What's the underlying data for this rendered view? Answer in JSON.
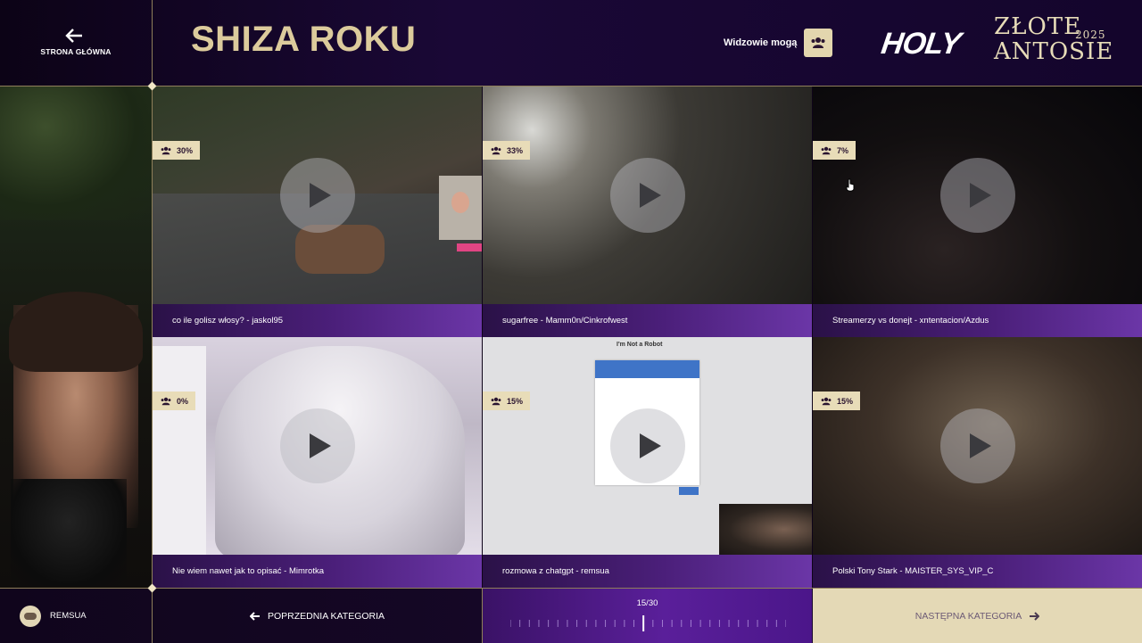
{
  "header": {
    "home_label": "STRONA GŁÓWNA",
    "category_title": "SHIZA ROKU",
    "viewers_label": "Widzowie mogą",
    "logo_brand": "HOLY",
    "logo_line1": "ZŁOTE",
    "logo_line2": "ANTOSIE",
    "logo_year": "2025"
  },
  "videos": [
    {
      "percent": "30%",
      "title": "co ile golisz włosy? - jaskol95"
    },
    {
      "percent": "33%",
      "title": "sugarfree - Mamm0n/Cinkrofwest"
    },
    {
      "percent": "7%",
      "title": "Streamerzy vs donejt - xntentacion/Azdus"
    },
    {
      "percent": "0%",
      "title": "Nie wiem nawet jak to opisać - Mimrotka"
    },
    {
      "percent": "15%",
      "title": "rozmowa z chatgpt - remsua"
    },
    {
      "percent": "15%",
      "title": "Polski Tony Stark - MAISTER_SYS_VIP_C"
    }
  ],
  "captcha": {
    "title": "I'm Not a Robot"
  },
  "footer": {
    "username": "REMSUA",
    "prev_label": "POPRZEDNIA KATEGORIA",
    "progress_text": "15/30",
    "progress_current": 15,
    "progress_total": 30,
    "next_label": "NASTĘPNA KATEGORIA"
  },
  "colors": {
    "gold": "#dccb9c",
    "accent_purple": "#5a1f9a",
    "badge": "#e8dcb8"
  }
}
